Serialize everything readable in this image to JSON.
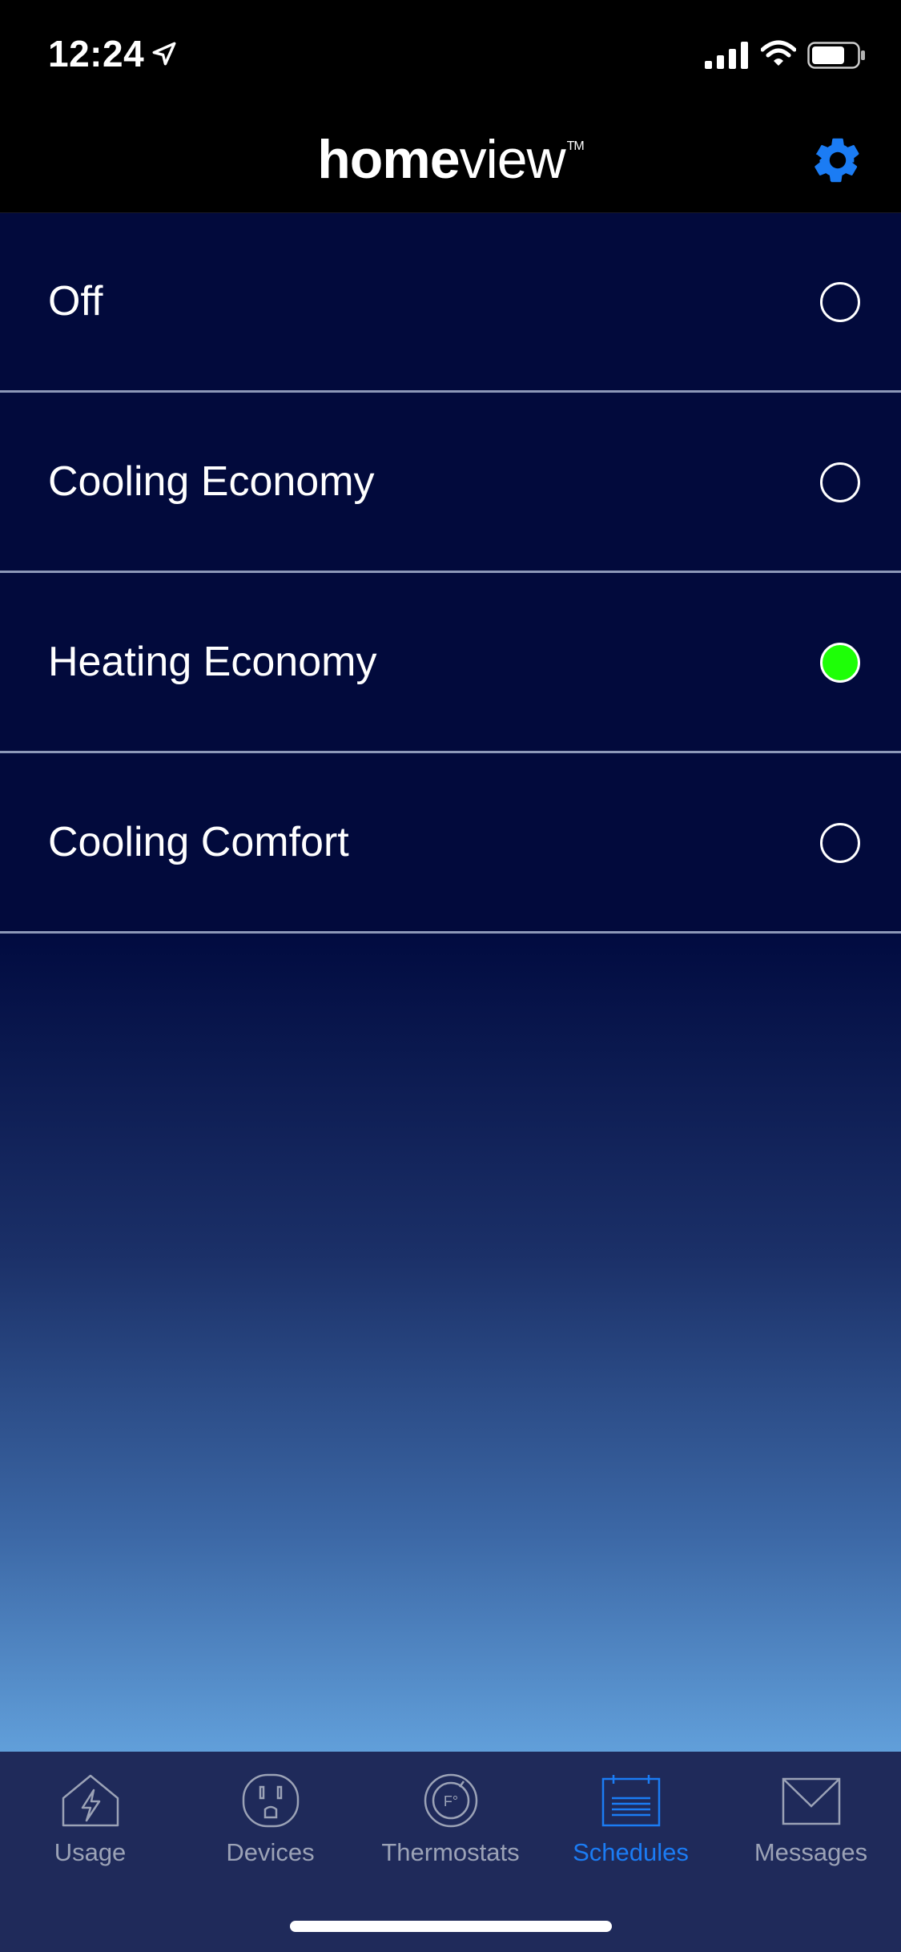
{
  "status": {
    "time": "12:24"
  },
  "header": {
    "logo_bold": "home",
    "logo_light": "view",
    "logo_tm": "TM"
  },
  "modes": [
    {
      "label": "Off",
      "selected": false
    },
    {
      "label": "Cooling Economy",
      "selected": false
    },
    {
      "label": "Heating Economy",
      "selected": true
    },
    {
      "label": "Cooling Comfort",
      "selected": false
    }
  ],
  "colors": {
    "selected_radio": "#1eff07",
    "accent": "#1b7cf4"
  },
  "tabs": [
    {
      "label": "Usage",
      "icon": "house-bolt-icon",
      "active": false
    },
    {
      "label": "Devices",
      "icon": "outlet-icon",
      "active": false
    },
    {
      "label": "Thermostats",
      "icon": "thermostat-icon",
      "active": false
    },
    {
      "label": "Schedules",
      "icon": "calendar-icon",
      "active": true
    },
    {
      "label": "Messages",
      "icon": "envelope-icon",
      "active": false
    }
  ]
}
